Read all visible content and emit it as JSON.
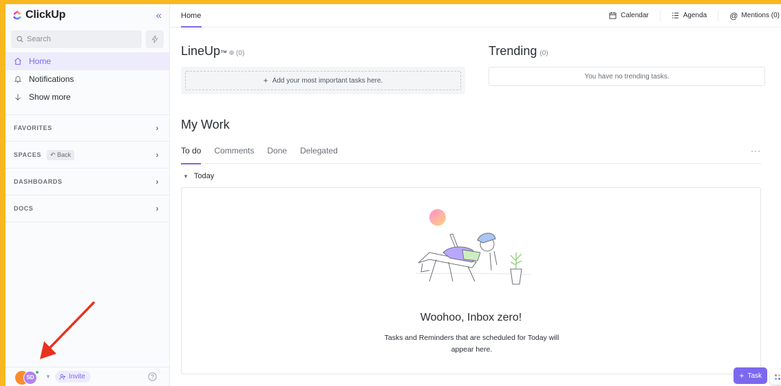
{
  "brand": {
    "name": "ClickUp"
  },
  "sidebar": {
    "search_placeholder": "Search",
    "nav": [
      {
        "label": "Home",
        "icon": "home-icon",
        "active": true
      },
      {
        "label": "Notifications",
        "icon": "bell-icon",
        "active": false
      },
      {
        "label": "Show more",
        "icon": "arrow-down-icon",
        "active": false
      }
    ],
    "sections": {
      "favorites": "FAVORITES",
      "spaces": "SPACES",
      "back": "Back",
      "dashboards": "DASHBOARDS",
      "docs": "DOCS"
    },
    "footer": {
      "avatar_initials": "SD",
      "invite_label": "Invite"
    }
  },
  "topbar": {
    "title": "Home",
    "calendar": "Calendar",
    "agenda": "Agenda",
    "mentions": "Mentions (0)"
  },
  "lineup": {
    "title": "LineUp",
    "tm": "™",
    "count": "(0)",
    "add_label": "Add your most important tasks here."
  },
  "trending": {
    "title": "Trending",
    "count": "(0)",
    "empty": "You have no trending tasks."
  },
  "mywork": {
    "title": "My Work",
    "tabs": [
      "To do",
      "Comments",
      "Done",
      "Delegated"
    ],
    "active_tab": "To do",
    "group": "Today",
    "empty_title": "Woohoo, Inbox zero!",
    "empty_sub": "Tasks and Reminders that are scheduled for Today will appear here."
  },
  "fab": {
    "task_label": "Task"
  },
  "colors": {
    "accent": "#7b68ee",
    "frame": "#f9b81f",
    "arrow": "#e8321e"
  }
}
